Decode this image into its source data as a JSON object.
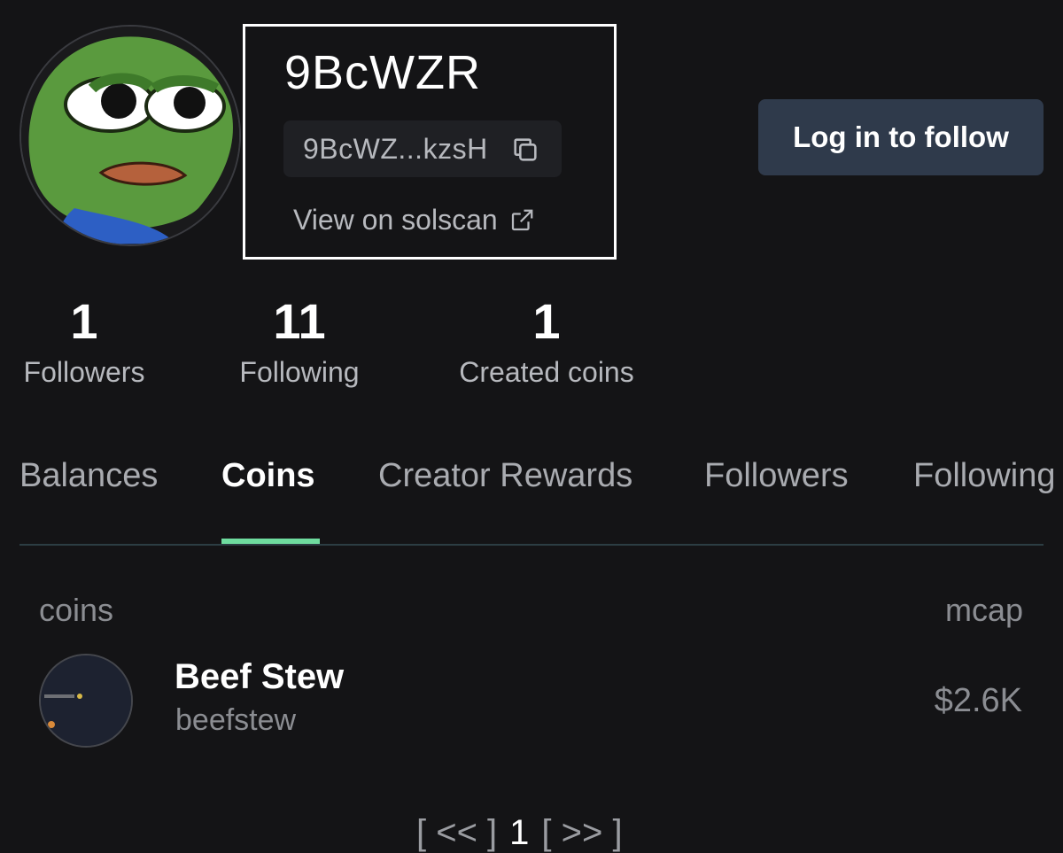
{
  "profile": {
    "username": "9BcWZR",
    "address_short": "9BcWZ...kzsH",
    "solscan_label": "View on solscan",
    "avatar_icon": "pepe-frog-avatar",
    "login_label": "Log in to follow"
  },
  "stats": [
    {
      "value": "1",
      "label": "Followers"
    },
    {
      "value": "11",
      "label": "Following"
    },
    {
      "value": "1",
      "label": "Created coins"
    }
  ],
  "tabs": [
    {
      "label": "Balances",
      "active": false
    },
    {
      "label": "Coins",
      "active": true
    },
    {
      "label": "Creator Rewards",
      "active": false
    },
    {
      "label": "Followers",
      "active": false
    },
    {
      "label": "Following",
      "active": false
    }
  ],
  "table": {
    "col_coins": "coins",
    "col_mcap": "mcap",
    "rows": [
      {
        "name": "Beef Stew",
        "ticker": "beefstew",
        "mcap": "$2.6K"
      }
    ]
  },
  "pagination": {
    "prev": "[ << ]",
    "page": "1",
    "next": "[ >> ]"
  },
  "colors": {
    "background": "#141416",
    "accent": "#6fdc9f",
    "button": "#2f3a4b"
  }
}
